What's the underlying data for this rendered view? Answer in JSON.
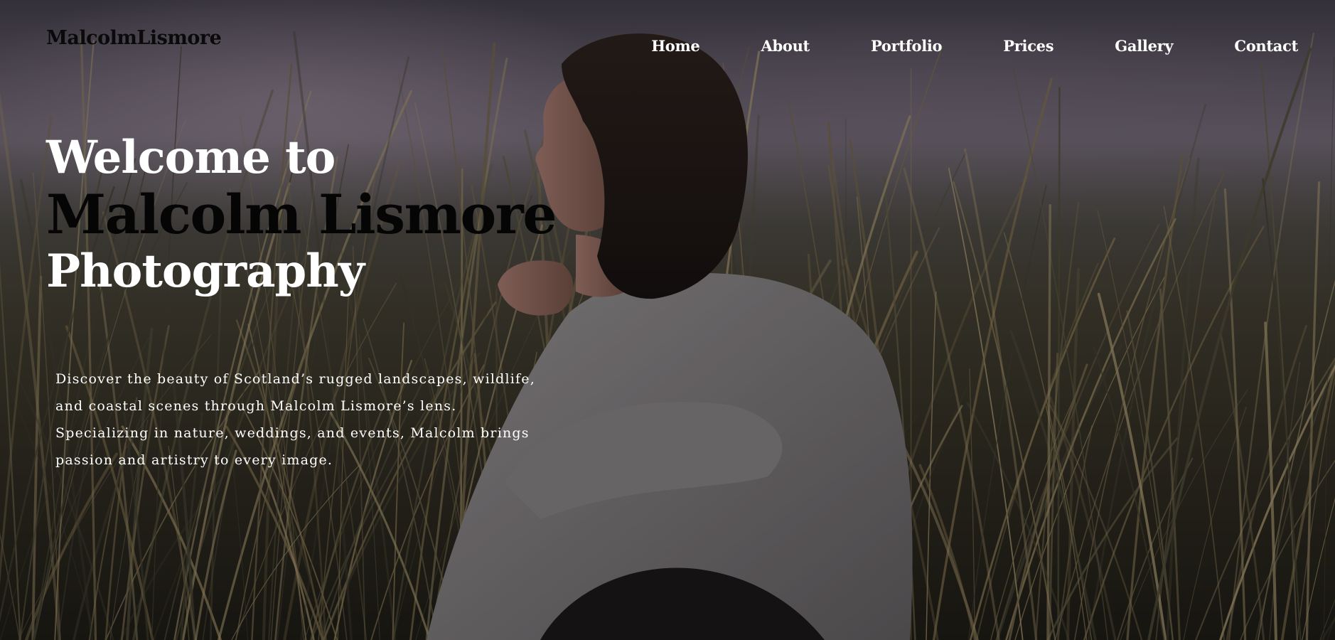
{
  "site": {
    "logo_text": "MalcolmLismore"
  },
  "nav": {
    "items": [
      {
        "label": "Home"
      },
      {
        "label": "About"
      },
      {
        "label": "Portfolio"
      },
      {
        "label": "Prices"
      },
      {
        "label": "Gallery"
      },
      {
        "label": "Contact"
      }
    ]
  },
  "hero": {
    "headline_line1": "Welcome to",
    "headline_line2": "Malcolm Lismore",
    "headline_line3": "Photography",
    "intro": "Discover the beauty of Scotland’s rugged landscapes, wildlife, and coastal scenes through Malcolm Lismore’s lens. Specializing in nature, weddings, and events, Malcolm brings passion and artistry to every image."
  },
  "colors": {
    "nav_text": "#ffffff",
    "logo_text": "#0a0a0a",
    "headline_accent": "#050505",
    "headline_light": "#ffffff"
  }
}
